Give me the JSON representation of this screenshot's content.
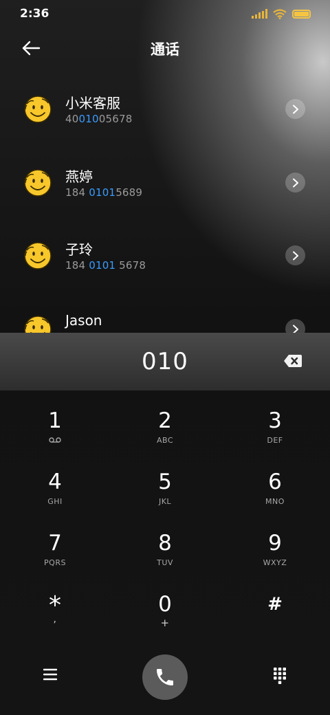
{
  "status_bar": {
    "time": "2:36",
    "icons": [
      "signal-icon",
      "wifi-icon",
      "battery-icon"
    ],
    "icon_color": "#f5c542"
  },
  "header": {
    "title": "通话",
    "back_icon": "arrow-left-icon"
  },
  "colors": {
    "highlight": "#3a9bff",
    "avatar": "#f7c72b"
  },
  "contacts": [
    {
      "name": "小米客服",
      "number_parts": [
        "40",
        "010",
        "05678"
      ]
    },
    {
      "name": "燕婷",
      "number_parts": [
        "184 ",
        "0101",
        "5689"
      ]
    },
    {
      "name": "子玲",
      "number_parts": [
        "184 ",
        "0101",
        " 5678"
      ]
    },
    {
      "name": "Jason",
      "number_parts": [
        "",
        "",
        ""
      ]
    }
  ],
  "dialer": {
    "input_value": "010",
    "backspace_icon": "backspace-icon"
  },
  "keypad": [
    {
      "digit": "1",
      "letters": "voicemail-icon"
    },
    {
      "digit": "2",
      "letters": "ABC"
    },
    {
      "digit": "3",
      "letters": "DEF"
    },
    {
      "digit": "4",
      "letters": "GHI"
    },
    {
      "digit": "5",
      "letters": "JKL"
    },
    {
      "digit": "6",
      "letters": "MNO"
    },
    {
      "digit": "7",
      "letters": "PQRS"
    },
    {
      "digit": "8",
      "letters": "TUV"
    },
    {
      "digit": "9",
      "letters": "WXYZ"
    },
    {
      "digit": "*",
      "letters": ","
    },
    {
      "digit": "0",
      "letters": "+"
    },
    {
      "digit": "#",
      "letters": ""
    }
  ],
  "bottom_bar": {
    "icons": [
      "menu-icon",
      "phone-call-icon",
      "dialpad-icon"
    ]
  }
}
